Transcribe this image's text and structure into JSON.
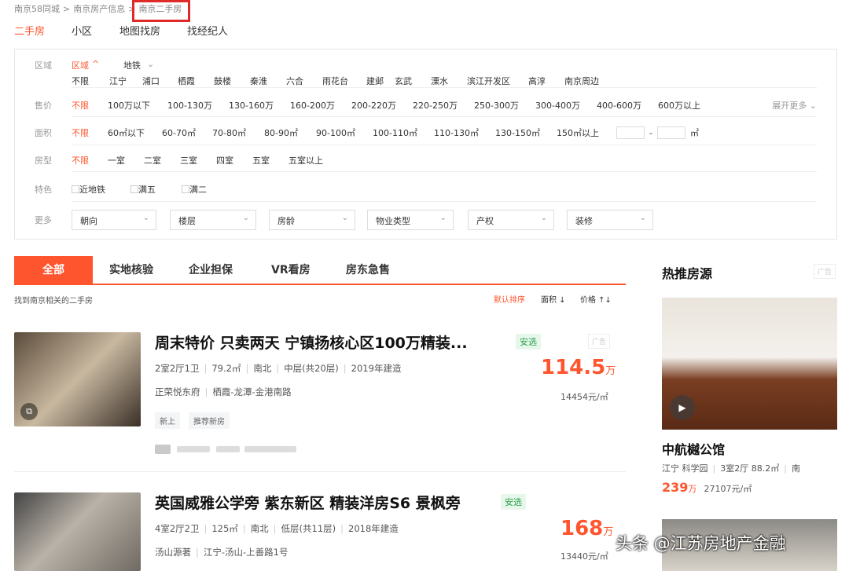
{
  "breadcrumb": {
    "items": [
      "南京58同城",
      "南京房产信息",
      "南京二手房"
    ],
    "sep": ">"
  },
  "topnav": [
    "二手房",
    "小区",
    "地图找房",
    "找经纪人"
  ],
  "filter": {
    "region": {
      "label": "区域",
      "mode_active": "区域",
      "mode_active_caret": "^",
      "mode_other": "地铁",
      "mode_other_caret": "⌄",
      "items": [
        "不限",
        "江宁",
        "浦口",
        "栖霞",
        "鼓楼",
        "秦淮",
        "六合",
        "雨花台",
        "建邺",
        "玄武",
        "溧水",
        "滨江开发区",
        "高淳",
        "南京周边"
      ]
    },
    "price": {
      "label": "售价",
      "items": [
        "不限",
        "100万以下",
        "100-130万",
        "130-160万",
        "160-200万",
        "200-220万",
        "220-250万",
        "250-300万",
        "300-400万",
        "400-600万",
        "600万以上"
      ],
      "expand": "展开更多 ⌄"
    },
    "area": {
      "label": "面积",
      "items": [
        "不限",
        "60㎡以下",
        "60-70㎡",
        "70-80㎡",
        "80-90㎡",
        "90-100㎡",
        "100-110㎡",
        "110-130㎡",
        "130-150㎡",
        "150㎡以上"
      ],
      "dash": "-",
      "unit": "㎡"
    },
    "rooms": {
      "label": "房型",
      "items": [
        "不限",
        "一室",
        "二室",
        "三室",
        "四室",
        "五室",
        "五室以上"
      ]
    },
    "features": {
      "label": "特色",
      "items": [
        "近地铁",
        "满五",
        "满二"
      ]
    },
    "more": {
      "label": "更多",
      "selects": [
        "朝向",
        "楼层",
        "房龄",
        "物业类型",
        "产权",
        "装修"
      ]
    }
  },
  "tabs": [
    "全部",
    "实地核验",
    "企业担保",
    "VR看房",
    "房东急售"
  ],
  "found_text": "找到南京相关的二手房",
  "sort": [
    "默认排序",
    "面积 ↓",
    "价格 ↑↓"
  ],
  "listings": [
    {
      "title": "周末特价 只卖两天 宁镇扬核心区100万精装...",
      "badge": "安选",
      "ad": "广告",
      "layout": "2室2厅1卫",
      "area": "79.2㎡",
      "orient": "南北",
      "floor": "中层(共20层)",
      "year": "2019年建造",
      "community": "正荣悦东府",
      "location": "栖霞-龙潭-金港南路",
      "tags": [
        "新上",
        "推荐新房"
      ],
      "price": "114.5",
      "price_unit": "万",
      "unit_price": "14454元/㎡"
    },
    {
      "title": "英国威雅公学旁 紫东新区 精装洋房S6 景枫旁",
      "badge": "安选",
      "layout": "4室2厅2卫",
      "area": "125㎡",
      "orient": "南北",
      "floor": "低层(共11层)",
      "year": "2018年建造",
      "community": "汤山源著",
      "location": "江宁-汤山-上善路1号",
      "price": "168",
      "price_unit": "万",
      "unit_price": "13440元/㎡"
    }
  ],
  "sidebar": {
    "title": "热推房源",
    "ad": "广告",
    "card": {
      "name": "中航樾公馆",
      "district": "江宁",
      "area_name": "科学园",
      "layout": "3室2厅",
      "size": "88.2㎡",
      "orient": "南",
      "price": "239",
      "price_unit": "万",
      "unit_price": "27107元/㎡"
    }
  },
  "watermark": "头条 @江苏房地产金融"
}
